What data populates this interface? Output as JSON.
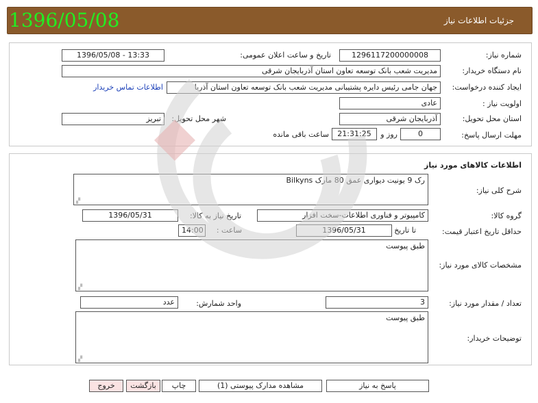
{
  "header": {
    "title": "جزئیات اطلاعات نیاز",
    "date": "1396/05/08"
  },
  "info": {
    "need_number_label": "شماره نیاز:",
    "need_number": "1296117200000008",
    "announce_label": "تاریخ و ساعت اعلان عمومی:",
    "announce_value": "1396/05/08 - 13:33",
    "buyer_org_label": "نام دستگاه خریدار:",
    "buyer_org": "مدیریت شعب بانک توسعه تعاون استان آذربایجان شرقی",
    "requester_label": "ایجاد کننده درخواست:",
    "requester": "جهان جامی رئیس دایره پشتیبانی مدیریت شعب بانک توسعه تعاون استان آذربا",
    "contact_link": "اطلاعات تماس خریدار",
    "priority_label": "اولویت نیاز :",
    "priority": "عادی",
    "province_label": "استان محل تحویل:",
    "province": "آذربایجان شرقی",
    "city_label": "شهر محل تحویل:",
    "city": "تبریز",
    "deadline_label": "مهلت ارسال پاسخ:",
    "days": "0",
    "days_word": "روز و",
    "time_left": "21:31:25",
    "remaining_word": "ساعت باقی مانده"
  },
  "goods": {
    "section_title": "اطلاعات کالاهای مورد نیاز",
    "summary_label": "شرح کلی نیاز:",
    "summary": "رک 9 یونیت دیواری عمق 80 مارک Bilkyns",
    "group_label": "گروه کالا:",
    "group": "کامپیوتر و فناوری اطلاعات-سخت افزار",
    "need_date_label": "تاریخ نیاز به کالا:",
    "need_date": "1396/05/31",
    "min_validity_label": "حداقل تاریخ اعتبار قیمت:",
    "to_date_label": "تا تاریخ :",
    "to_date": "1396/05/31",
    "hour_label": "ساعت :",
    "hour": "14:00",
    "specs_label": "مشخصات کالای مورد نیاز:",
    "specs": "طبق پیوست",
    "qty_label": "تعداد / مقدار مورد نیاز:",
    "qty": "3",
    "unit_label": "واحد شمارش:",
    "unit": "عدد",
    "buyer_notes_label": "توضیحات خریدار:",
    "buyer_notes": "طبق پیوست"
  },
  "buttons": {
    "respond": "پاسخ به نیاز",
    "view_docs": "مشاهده مدارک پیوستی (1)",
    "print": "چاپ",
    "back": "بازگشت",
    "exit": "خروج"
  },
  "colors": {
    "header_bg": "#8a5a2b",
    "date_text": "#22ee22",
    "link": "#1a3fb8",
    "pink_button": "#fbe3e3"
  }
}
